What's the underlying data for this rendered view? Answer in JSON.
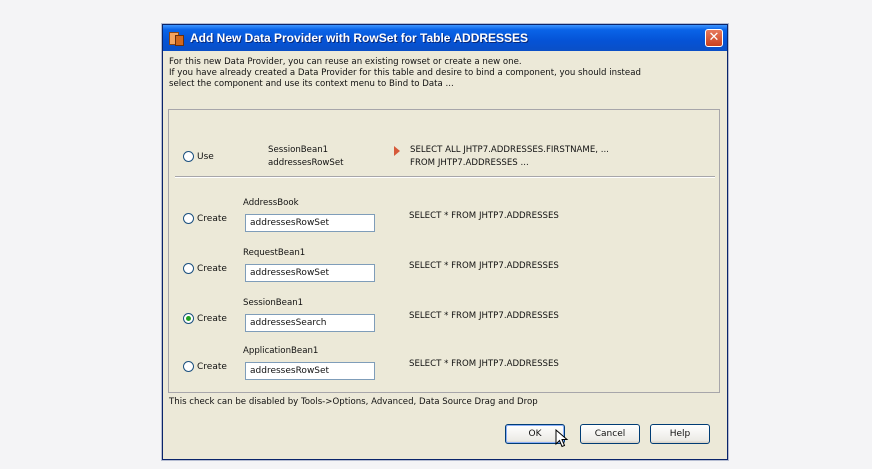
{
  "dialog": {
    "title": "Add New Data Provider with RowSet for Table ADDRESSES",
    "close_label": "✕",
    "info_lines": [
      "For this new Data Provider, you can reuse an existing rowset or create a new one.",
      "If you have already created a Data Provider for this table and desire to bind a component, you should instead",
      "select the component and use its context menu to Bind to Data ..."
    ]
  },
  "use_option": {
    "radio_label": "Use",
    "bean": "SessionBean1",
    "rowset": "addressesRowSet",
    "sql_line1": "SELECT ALL JHTP7.ADDRESSES.FIRSTNAME, ...",
    "sql_line2": "FROM JHTP7.ADDRESSES ...",
    "selected": false
  },
  "create_options": [
    {
      "radio_label": "Create",
      "bean": "AddressBook",
      "rowset": "addressesRowSet",
      "sql": "SELECT * FROM JHTP7.ADDRESSES",
      "selected": false
    },
    {
      "radio_label": "Create",
      "bean": "RequestBean1",
      "rowset": "addressesRowSet",
      "sql": "SELECT * FROM JHTP7.ADDRESSES",
      "selected": false
    },
    {
      "radio_label": "Create",
      "bean": "SessionBean1",
      "rowset": "addressesSearch",
      "sql": "SELECT * FROM JHTP7.ADDRESSES",
      "selected": true
    },
    {
      "radio_label": "Create",
      "bean": "ApplicationBean1",
      "rowset": "addressesRowSet",
      "sql": "SELECT * FROM JHTP7.ADDRESSES",
      "selected": false
    }
  ],
  "footer_note": "This check can be disabled by Tools->Options, Advanced, Data Source Drag and Drop",
  "buttons": {
    "ok": "OK",
    "cancel": "Cancel",
    "help": "Help"
  },
  "colors": {
    "title_bar": "#0553d6",
    "dialog_bg": "#ece9d8",
    "selected_radio": "#21a121"
  }
}
